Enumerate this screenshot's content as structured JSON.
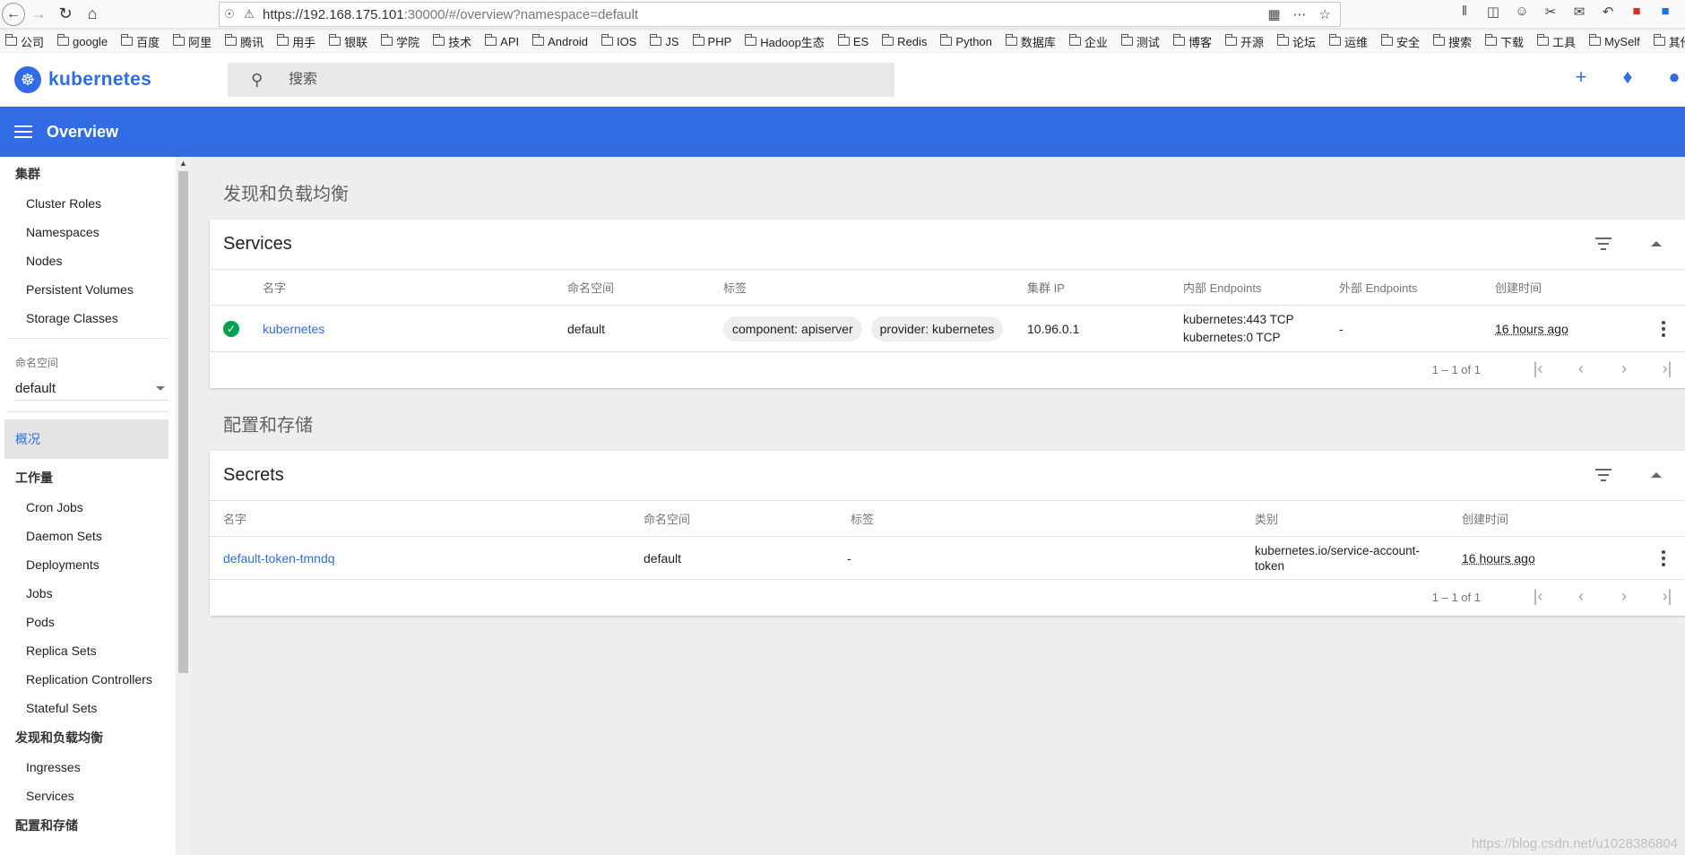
{
  "browser": {
    "url_host": "https://192.168.175.101",
    "url_rest": ":30000/#/overview?namespace=default"
  },
  "bookmarks": [
    "公司",
    "google",
    "百度",
    "阿里",
    "腾讯",
    "用手",
    "银联",
    "学院",
    "技术",
    "API",
    "Android",
    "IOS",
    "JS",
    "PHP",
    "Hadoop生态",
    "ES",
    "Redis",
    "Python",
    "数据库",
    "企业",
    "测试",
    "博客",
    "开源",
    "论坛",
    "运维",
    "安全",
    "搜索",
    "下载",
    "工具",
    "MySelf",
    "其他"
  ],
  "app": {
    "logo_text": "kubernetes",
    "search_placeholder": "搜索",
    "page_title": "Overview"
  },
  "sidebar": {
    "cluster_header": "集群",
    "cluster_items": [
      "Cluster Roles",
      "Namespaces",
      "Nodes",
      "Persistent Volumes",
      "Storage Classes"
    ],
    "namespace_label": "命名空间",
    "namespace_value": "default",
    "overview": "概况",
    "workloads_header": "工作量",
    "workload_items": [
      "Cron Jobs",
      "Daemon Sets",
      "Deployments",
      "Jobs",
      "Pods",
      "Replica Sets",
      "Replication Controllers",
      "Stateful Sets"
    ],
    "discovery_header": "发现和负载均衡",
    "discovery_items": [
      "Ingresses",
      "Services"
    ],
    "config_header": "配置和存储"
  },
  "discovery_section": {
    "title": "发现和负载均衡",
    "card_title": "Services",
    "headers": {
      "name": "名字",
      "namespace": "命名空间",
      "labels": "标签",
      "cluster_ip": "集群 IP",
      "internal_endpoints": "内部 Endpoints",
      "external_endpoints": "外部 Endpoints",
      "created": "创建时间"
    },
    "row": {
      "name": "kubernetes",
      "namespace": "default",
      "label1": "component: apiserver",
      "label2": "provider: kubernetes",
      "cluster_ip": "10.96.0.1",
      "internal1": "kubernetes:443 TCP",
      "internal2": "kubernetes:0 TCP",
      "external": "-",
      "created": "16 hours ago"
    },
    "pager": "1 – 1 of 1"
  },
  "config_section": {
    "title": "配置和存储",
    "card_title": "Secrets",
    "headers": {
      "name": "名字",
      "namespace": "命名空间",
      "labels": "标签",
      "type": "类别",
      "created": "创建时间"
    },
    "row": {
      "name": "default-token-tmndq",
      "namespace": "default",
      "labels": "-",
      "type1": "kubernetes.io/service-account-",
      "type2": "token",
      "created": "16 hours ago"
    },
    "pager": "1 – 1 of 1"
  },
  "watermark": "https://blog.csdn.net/u1028386804"
}
